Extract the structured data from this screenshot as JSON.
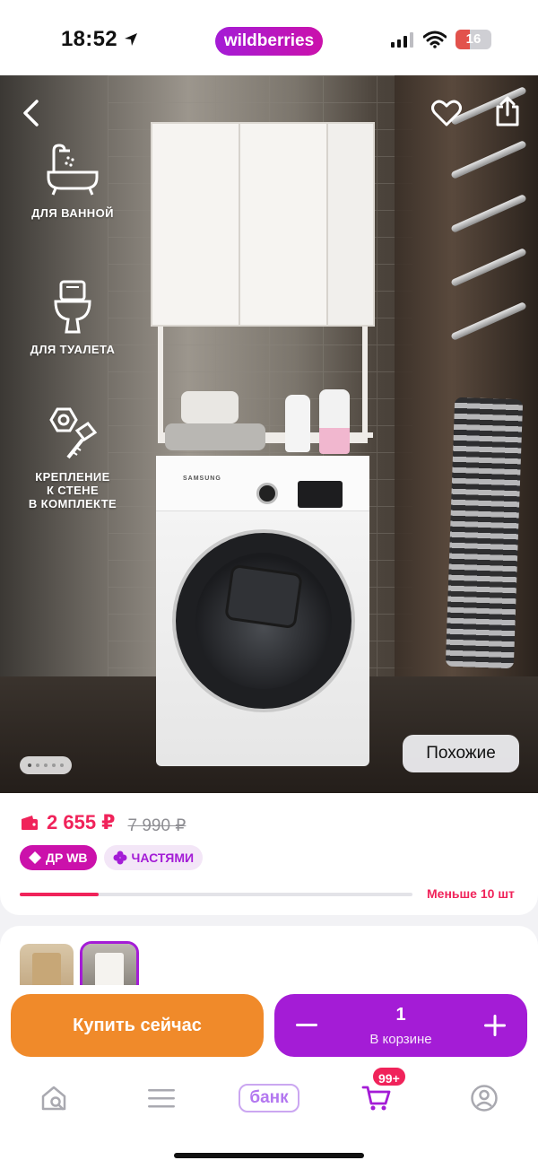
{
  "status_bar": {
    "time": "18:52",
    "brand": "wildberries",
    "battery": "16"
  },
  "gallery": {
    "features": [
      {
        "icon": "bathtub-icon",
        "label": "ДЛЯ ВАННОЙ"
      },
      {
        "icon": "toilet-icon",
        "label": "ДЛЯ ТУАЛЕТА"
      },
      {
        "icon": "wall-mount-screw-icon",
        "label": "КРЕПЛЕНИЕ\nК СТЕНЕ\nВ КОМПЛЕКТЕ"
      }
    ],
    "washer_brand": "SAMSUNG",
    "similar_label": "Похожие",
    "page_count": 5,
    "active_page": 1
  },
  "price": {
    "current": "2 655 ₽",
    "old": "7 990 ₽",
    "badges": {
      "dr_wb": "ДР WB",
      "parts": "ЧАСТЯМИ"
    },
    "stock_label": "Меньше 10 шт",
    "stock_level": 0.2
  },
  "actions": {
    "buy_now": "Купить сейчас",
    "cart_qty": "1",
    "cart_sub": "В корзине"
  },
  "tabbar": {
    "bank_label": "банк",
    "cart_badge": "99+"
  },
  "colors": {
    "accent_purple": "#a41cd6",
    "accent_pink": "#cb11ab",
    "price_red": "#f0235a",
    "buy_orange": "#f08a2a"
  }
}
